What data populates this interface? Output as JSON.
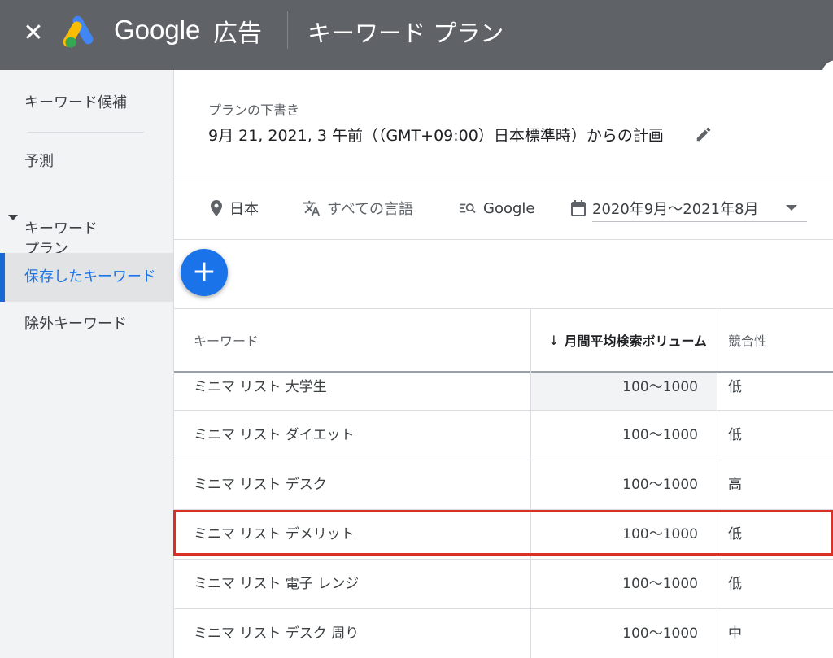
{
  "header": {
    "close_icon": "close-icon",
    "brand_google": "Google",
    "brand_product": "広告",
    "page_title": "キーワード プラン"
  },
  "sidebar": {
    "items": [
      {
        "label": "キーワード候補"
      },
      {
        "label": "予測"
      },
      {
        "label": "キーワード\nプラン"
      },
      {
        "label": "保存したキーワード",
        "active": true
      },
      {
        "label": "除外キーワード"
      }
    ]
  },
  "plan": {
    "draft_label": "プランの下書き",
    "draft_date": "9月 21, 2021, 3 午前（（GMT+09:00）日本標準時）からの計画"
  },
  "filters": {
    "location": "日本",
    "language": "すべての言語",
    "network": "Google",
    "date_range": "2020年9月～2021年8月"
  },
  "add_button": "+",
  "table": {
    "headers": {
      "keyword": "キーワード",
      "volume": "月間平均検索ボリューム",
      "competition": "競合性"
    },
    "rows": [
      {
        "keyword": "ミニマ リスト 大学生",
        "volume": "100～1000",
        "competition": "低"
      },
      {
        "keyword": "ミニマ リスト ダイエット",
        "volume": "100～1000",
        "competition": "低"
      },
      {
        "keyword": "ミニマ リスト デスク",
        "volume": "100～1000",
        "competition": "高"
      },
      {
        "keyword": "ミニマ リスト デメリット",
        "volume": "100～1000",
        "competition": "低",
        "highlighted": true
      },
      {
        "keyword": "ミニマ リスト 電子 レンジ",
        "volume": "100～1000",
        "competition": "低"
      },
      {
        "keyword": "ミニマ リスト デスク 周り",
        "volume": "100～1000",
        "competition": "中"
      }
    ]
  },
  "colors": {
    "topbar": "#5f6368",
    "accent": "#1a73e8",
    "highlight_border": "#d93025",
    "sidebar_bg": "#f1f3f4"
  }
}
